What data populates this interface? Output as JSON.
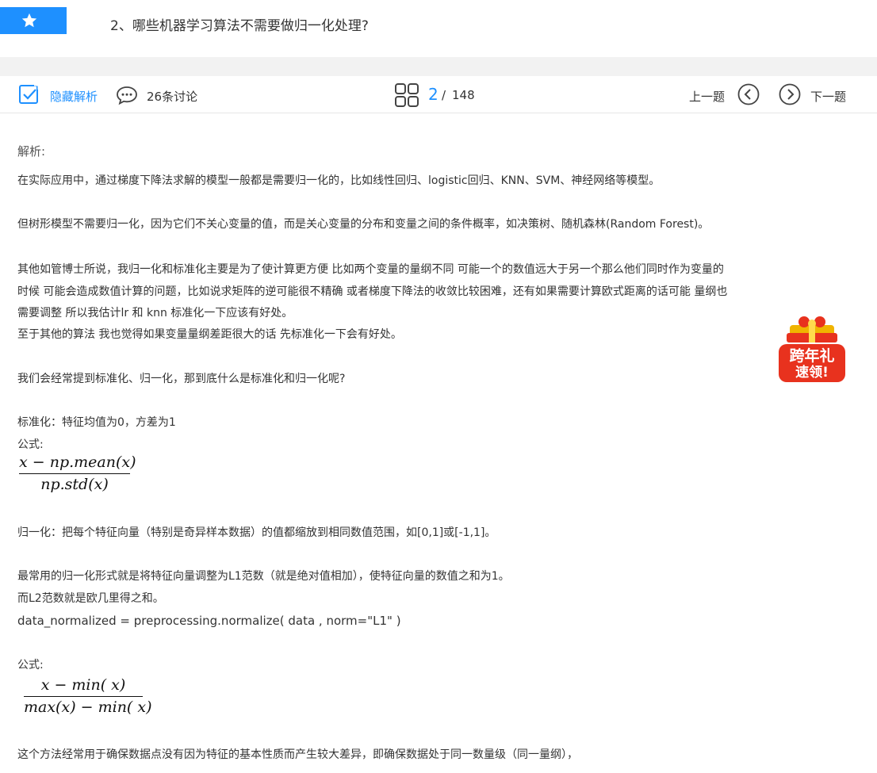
{
  "question": {
    "title": "2、哪些机器学习算法不需要做归一化处理?",
    "star_icon": "star-icon"
  },
  "toolbar": {
    "hide_label": "隐藏解析",
    "comments_label": "26条讨论",
    "page_current": "2",
    "page_separator": "/",
    "page_total": "148",
    "prev_label": "上一题",
    "next_label": "下一题",
    "accent_color": "#1e90ff"
  },
  "analysis": {
    "heading": "解析:",
    "lines": [
      "在实际应用中，通过梯度下降法求解的模型一般都是需要归一化的，比如线性回归、logistic回归、KNN、SVM、神经网络等模型。",
      "但树形模型不需要归一化，因为它们不关心变量的值，而是关心变量的分布和变量之间的条件概率，如决策树、随机森林(Random Forest)。",
      "其他如管博士所说，我归一化和标准化主要是为了使计算更方便 比如两个变量的量纲不同 可能一个的数值远大于另一个那么他们同时作为变量的",
      "时候 可能会造成数值计算的问题，比如说求矩阵的逆可能很不精确 或者梯度下降法的收敛比较困难，还有如果需要计算欧式距离的话可能 量纲也",
      "需要调整 所以我估计lr 和 knn 标准化一下应该有好处。",
      "至于其他的算法 我也觉得如果变量量纲差距很大的话 先标准化一下会有好处。",
      "我们会经常提到标准化、归一化，那到底什么是标准化和归一化呢?",
      "标准化：特征均值为0，方差为1",
      "公式:",
      "归一化：把每个特征向量（特别是奇异样本数据）的值都缩放到相同数值范围，如[0,1]或[-1,1]。",
      "最常用的归一化形式就是将特征向量调整为L1范数（就是绝对值相加），使特征向量的数值之和为1。",
      "而L2范数就是欧几里得之和。",
      "data_normalized = preprocessing.normalize( data , norm=\"L1\" )",
      "公式:",
      "这个方法经常用于确保数据点没有因为特征的基本性质而产生较大差异，即确保数据处于同一数量级（同一量纲），"
    ],
    "formula1": {
      "numerator": "x − np.mean(x)",
      "denominator": "np.std(x)"
    },
    "formula2": {
      "numerator": "x − min( x)",
      "denominator": "max(x) − min( x)"
    }
  },
  "promo": {
    "line1": "跨年礼",
    "line2": "速领!",
    "icon": "gift-box-icon"
  }
}
